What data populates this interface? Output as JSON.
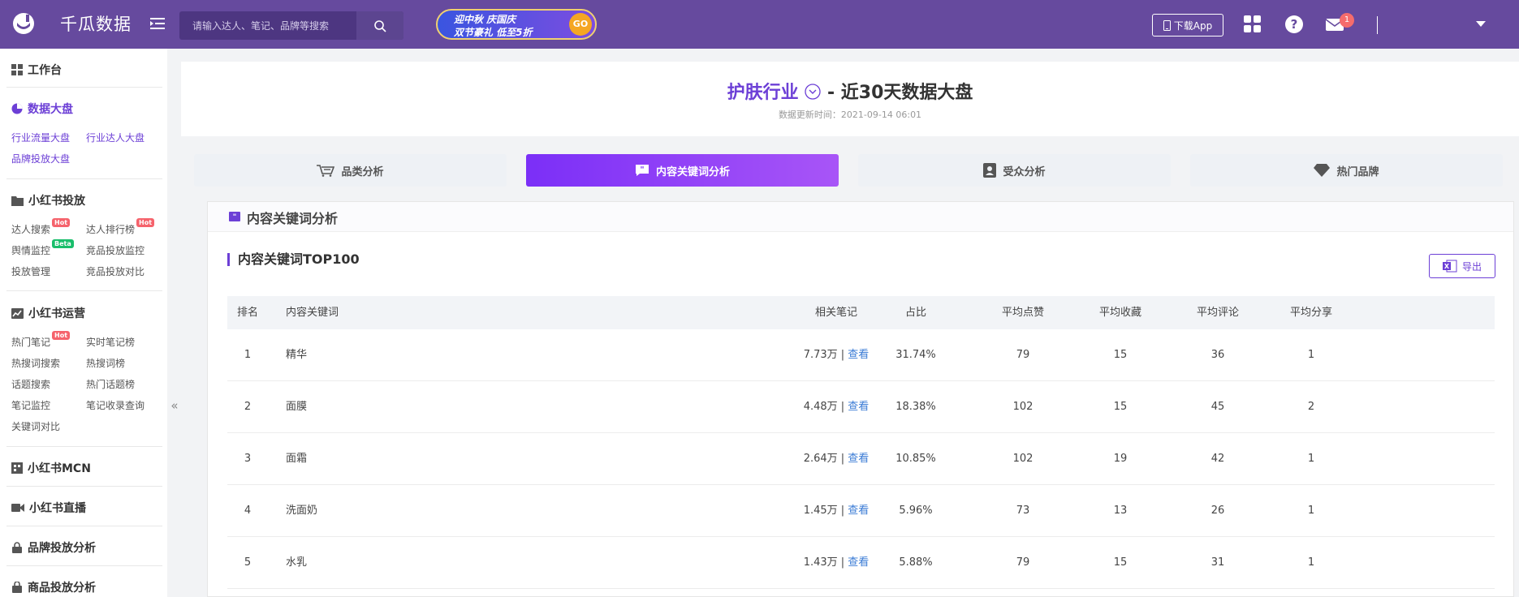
{
  "app": {
    "name": "千瓜数据"
  },
  "search": {
    "placeholder": "请输入达人、笔记、品牌等搜索"
  },
  "promo": {
    "line1": "迎中秋 庆国庆",
    "line2": "双节豪礼 低至5折",
    "go": "GO"
  },
  "topbar": {
    "download_label": "下载App",
    "notification_count": "1"
  },
  "sidebar": {
    "workbench": "工作台",
    "dashboard": {
      "title": "数据大盘",
      "items": [
        "行业流量大盘",
        "行业达人大盘",
        "品牌投放大盘"
      ]
    },
    "xhs_ads": {
      "title": "小红书投放",
      "items": [
        "达人搜索",
        "达人排行榜",
        "舆情监控",
        "竞品投放监控",
        "投放管理",
        "竞品投放对比"
      ]
    },
    "xhs_ops": {
      "title": "小红书运营",
      "items": [
        "热门笔记",
        "实时笔记榜",
        "热搜词搜索",
        "热搜词榜",
        "话题搜索",
        "热门话题榜",
        "笔记监控",
        "笔记收录查询",
        "关键词对比"
      ]
    },
    "mcn": "小红书MCN",
    "live": "小红书直播",
    "brand_analysis": "品牌投放分析",
    "product_analysis": "商品投放分析",
    "tags": {
      "hot": "Hot",
      "beta": "Beta"
    },
    "collapse": "«"
  },
  "header": {
    "industry": "护肤行业",
    "title_suffix": " - 近30天数据大盘",
    "update_time": "数据更新时间：2021-09-14 06:01"
  },
  "tabs": [
    "品类分析",
    "内容关键词分析",
    "受众分析",
    "热门品牌"
  ],
  "panel": {
    "title": "内容关键词分析",
    "subtitle": "内容关键词TOP100",
    "export_label": "导出"
  },
  "table": {
    "columns": [
      "排名",
      "内容关键词",
      "相关笔记",
      "占比",
      "平均点赞",
      "平均收藏",
      "平均评论",
      "平均分享"
    ],
    "view_label": "查看",
    "rows": [
      {
        "rank": "1",
        "keyword": "精华",
        "notes": "7.73万 |",
        "ratio": "31.74%",
        "likes": "79",
        "favs": "15",
        "comments": "36",
        "shares": "1"
      },
      {
        "rank": "2",
        "keyword": "面膜",
        "notes": "4.48万 |",
        "ratio": "18.38%",
        "likes": "102",
        "favs": "15",
        "comments": "45",
        "shares": "2"
      },
      {
        "rank": "3",
        "keyword": "面霜",
        "notes": "2.64万 |",
        "ratio": "10.85%",
        "likes": "102",
        "favs": "19",
        "comments": "42",
        "shares": "1"
      },
      {
        "rank": "4",
        "keyword": "洗面奶",
        "notes": "1.45万 |",
        "ratio": "5.96%",
        "likes": "73",
        "favs": "13",
        "comments": "26",
        "shares": "1"
      },
      {
        "rank": "5",
        "keyword": "水乳",
        "notes": "1.43万 |",
        "ratio": "5.88%",
        "likes": "79",
        "favs": "15",
        "comments": "31",
        "shares": "1"
      }
    ]
  },
  "colors": {
    "brand": "#664a9e",
    "accent": "#6c3fd6",
    "link": "#3a7bd5",
    "hot": "#f5636c",
    "beta": "#19be6b"
  },
  "icons": [
    "logo-icon",
    "menu-toggle-icon",
    "search-icon",
    "phone-icon",
    "grid-icon",
    "help-icon",
    "mail-icon",
    "chevron-down-icon",
    "cart-icon",
    "quote-icon",
    "person-card-icon",
    "diamond-icon",
    "excel-icon"
  ]
}
